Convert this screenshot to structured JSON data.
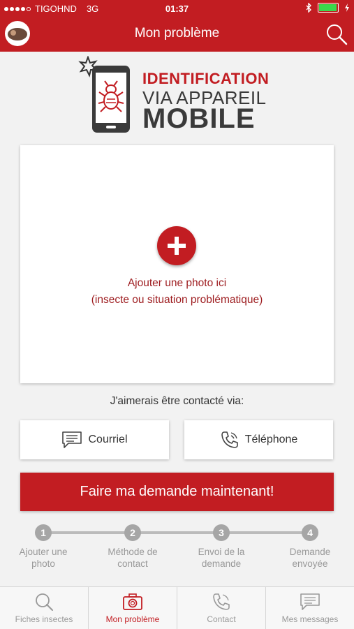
{
  "status_bar": {
    "carrier": "TIGOHND",
    "network": "3G",
    "time": "01:37"
  },
  "header": {
    "title": "Mon problème"
  },
  "logo": {
    "line1": "IDENTIFICATION",
    "line2": "VIA APPAREIL",
    "line3": "MOBILE"
  },
  "photo_area": {
    "line1": "Ajouter une photo ici",
    "line2": "(insecte ou situation problématique)"
  },
  "contact": {
    "prompt": "J'aimerais être contacté via:",
    "email_label": "Courriel",
    "phone_label": "Téléphone"
  },
  "request_button": "Faire ma demande maintenant!",
  "steps": [
    {
      "num": "1",
      "label1": "Ajouter une",
      "label2": "photo"
    },
    {
      "num": "2",
      "label1": "Méthode de",
      "label2": "contact"
    },
    {
      "num": "3",
      "label1": "Envoi de la",
      "label2": "demande"
    },
    {
      "num": "4",
      "label1": "Demande",
      "label2": "envoyée"
    }
  ],
  "tabs": [
    {
      "label": "Fiches insectes",
      "icon": "search-icon"
    },
    {
      "label": "Mon problème",
      "icon": "camera-icon"
    },
    {
      "label": "Contact",
      "icon": "phone-icon"
    },
    {
      "label": "Mes messages",
      "icon": "message-icon"
    }
  ],
  "colors": {
    "brand_red": "#c21d22",
    "step_gray": "#a6a6a6"
  }
}
